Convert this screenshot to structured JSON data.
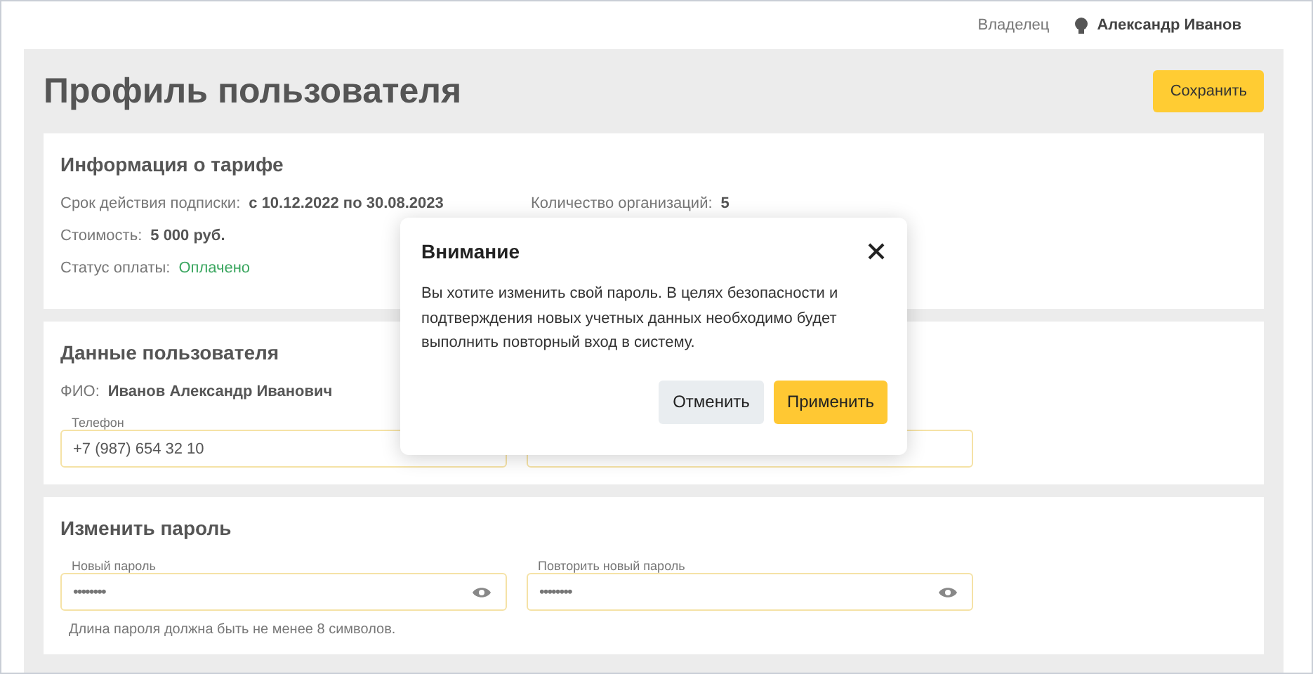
{
  "header": {
    "role": "Владелец",
    "user": "Александр Иванов"
  },
  "page": {
    "title": "Профиль пользователя",
    "save_button": "Сохранить"
  },
  "tariff": {
    "title": "Информация о тарифе",
    "left": [
      {
        "label": "Срок действия подписки:",
        "value": "с 10.12.2022 по 30.08.2023",
        "kind": "plain"
      },
      {
        "label": "Стоимость:",
        "value": "5 000 руб.",
        "kind": "plain"
      },
      {
        "label": "Статус оплаты:",
        "value": "Оплачено",
        "kind": "status"
      }
    ],
    "right": [
      {
        "label": "Количество организаций:",
        "value": "5"
      }
    ]
  },
  "user_data": {
    "title": "Данные пользователя",
    "fio_label": "ФИО:",
    "fio_value": "Иванов Александр Иванович",
    "phone": {
      "label": "Телефон",
      "value": "+7 (987) 654 32 10"
    }
  },
  "password": {
    "title": "Изменить пароль",
    "fields": [
      {
        "label": "Новый пароль",
        "value": "••••••••"
      },
      {
        "label": "Повторить новый пароль",
        "value": "••••••••"
      }
    ],
    "hint": "Длина пароля должна быть не менее 8 символов."
  },
  "dialog": {
    "title": "Внимание",
    "message": "Вы хотите изменить свой пароль. В целях безопасности и подтверждения новых учетных данных необходимо будет выполнить повторный вход в систему.",
    "cancel": "Отменить",
    "apply": "Применить"
  }
}
